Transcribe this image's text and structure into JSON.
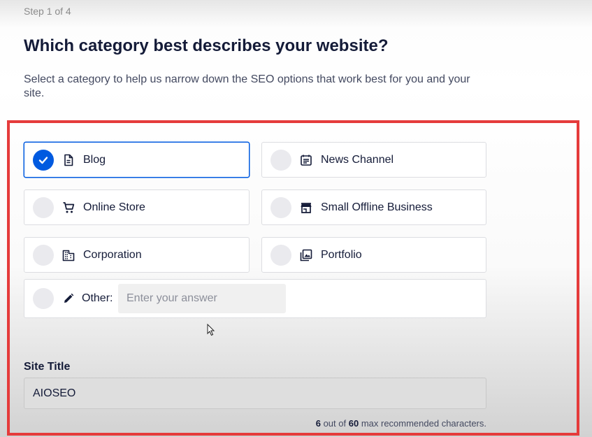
{
  "header": {
    "step": "Step 1 of 4",
    "title": "Which category best describes your website?",
    "description": "Select a category to help us narrow down the SEO options that work best for you and your site."
  },
  "categories": [
    {
      "label": "Blog",
      "icon": "document-icon",
      "selected": true
    },
    {
      "label": "News Channel",
      "icon": "newspaper-icon",
      "selected": false
    },
    {
      "label": "Online Store",
      "icon": "shopping-cart-icon",
      "selected": false
    },
    {
      "label": "Small Offline Business",
      "icon": "storefront-icon",
      "selected": false
    },
    {
      "label": "Corporation",
      "icon": "office-building-icon",
      "selected": false
    },
    {
      "label": "Portfolio",
      "icon": "image-gallery-icon",
      "selected": false
    }
  ],
  "other": {
    "label": "Other:",
    "icon": "pencil-icon",
    "placeholder": "Enter your answer",
    "value": ""
  },
  "site_title": {
    "label": "Site Title",
    "value": "AIOSEO",
    "count": "6",
    "max": "60",
    "counter_text_mid": "out of",
    "counter_text_end": "max recommended characters."
  },
  "colors": {
    "accent": "#005ae0",
    "highlight_border": "#e53b3b",
    "text": "#141b38"
  }
}
